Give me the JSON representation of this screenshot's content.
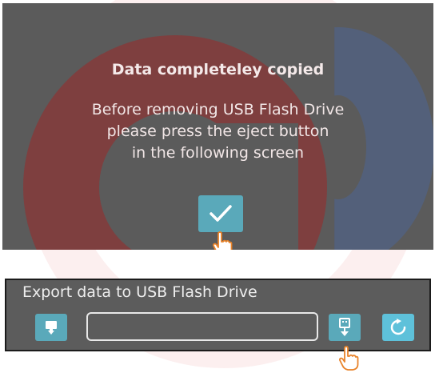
{
  "dialog": {
    "title": "Data completeley copied",
    "message_lines": [
      "Before removing USB Flash Drive",
      "please press the eject button",
      "in the following screen"
    ],
    "confirm_icon": "checkmark-icon"
  },
  "export_panel": {
    "title": "Export data to USB Flash Drive",
    "path_value": "",
    "buttons": {
      "left_icon": "monitor-export-icon",
      "eject_icon": "usb-eject-icon",
      "refresh_icon": "refresh-icon"
    }
  },
  "colors": {
    "dialog_bg": "#5b5b5b",
    "button_teal": "#5aa9ba",
    "refresh_button": "#5ec1da",
    "cursor_orange": "#e8832a"
  }
}
